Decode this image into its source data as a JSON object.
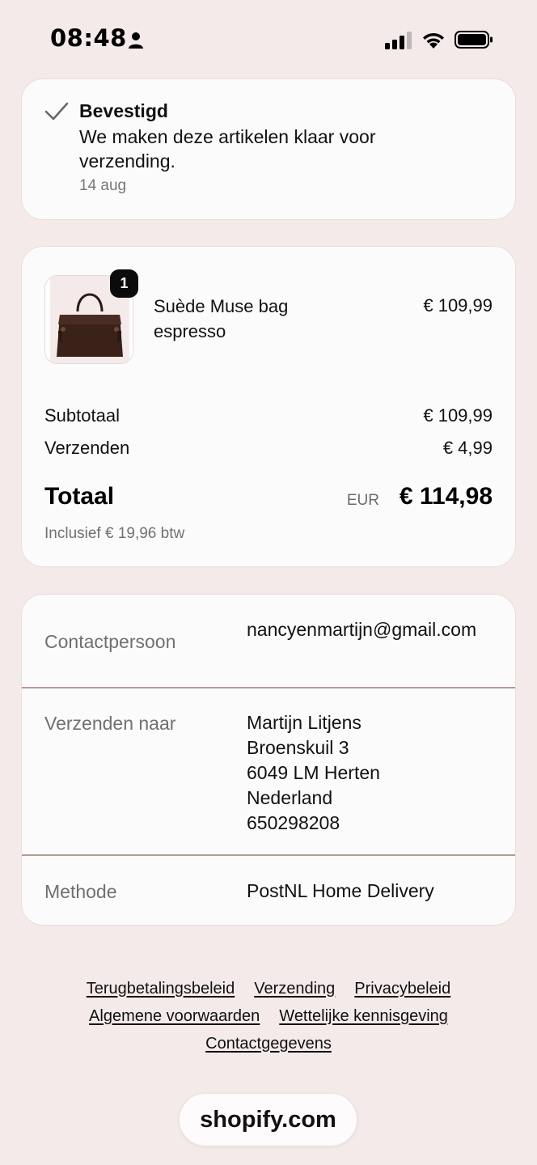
{
  "status_bar": {
    "time": "08:48"
  },
  "confirmation": {
    "title": "Bevestigd",
    "text": "We maken deze artikelen klaar voor verzending.",
    "date": "14 aug"
  },
  "order": {
    "product": {
      "name": "Suède Muse bag espresso",
      "price": "€ 109,99",
      "quantity": "1"
    },
    "subtotal_label": "Subtotaal",
    "subtotal_value": "€ 109,99",
    "shipping_label": "Verzenden",
    "shipping_value": "€ 4,99",
    "total_label": "Totaal",
    "total_currency": "EUR",
    "total_value": "€ 114,98",
    "tax_note": "Inclusief € 19,96 btw"
  },
  "details": {
    "contact_label": "Contactpersoon",
    "contact_value": "nancyenmartijn@gmail.com",
    "ship_to_label": "Verzenden naar",
    "address": [
      "Martijn Litjens",
      "Broenskuil 3",
      "6049 LM Herten",
      "Nederland",
      "650298208"
    ],
    "method_label": "Methode",
    "method_value": "PostNL Home Delivery"
  },
  "footer": {
    "links": [
      "Terugbetalingsbeleid",
      "Verzending",
      "Privacybeleid",
      "Algemene voorwaarden",
      "Wettelijke kennisgeving",
      "Contactgegevens"
    ],
    "shopify": "shopify.com"
  }
}
